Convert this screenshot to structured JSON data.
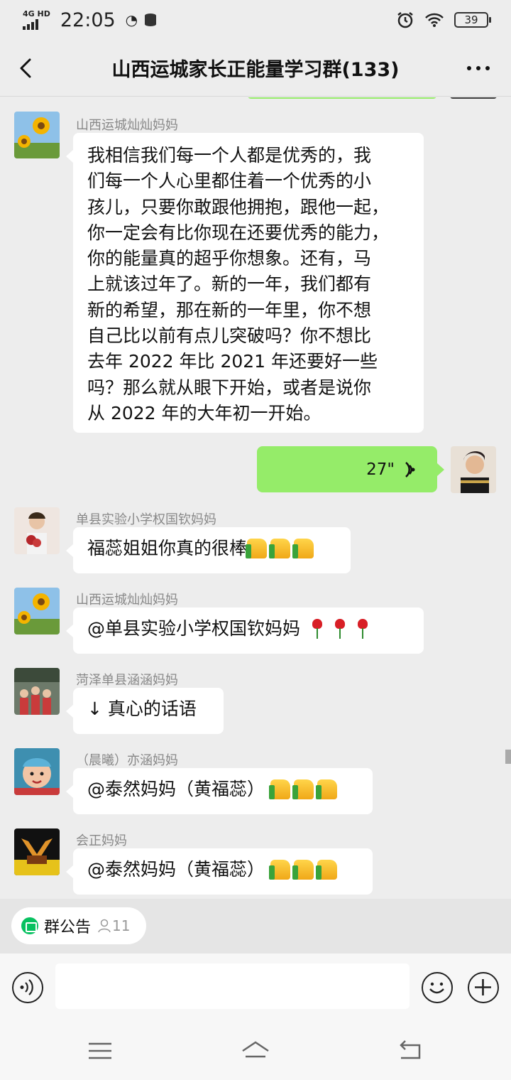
{
  "status_bar": {
    "network": "4G HD",
    "time": "22:05",
    "battery": "39"
  },
  "header": {
    "title": "山西运城家长正能量学习群(133)"
  },
  "messages": [
    {
      "sender": "山西运城灿灿妈妈",
      "text": "我相信我们每一个人都是优秀的，我\n们每一个人心里都住着一个优秀的小\n孩儿，只要你敢跟他拥抱，跟他一起，\n你一定会有比你现在还要优秀的能力，\n你的能量真的超乎你想象。还有，马\n上就该过年了。新的一年，我们都有\n新的希望，那在新的一年里，你不想\n自己比以前有点儿突破吗？你不想比\n去年 2022 年比 2021 年还要好一些\n吗？那么就从眼下开始，或者是说你\n从 2022 年的大年初一开始。"
    },
    {
      "voice_duration": "27\""
    },
    {
      "sender": "单县实验小学权国钦妈妈",
      "text": "福蕊姐姐你真的很棒"
    },
    {
      "sender": "山西运城灿灿妈妈",
      "text": "@单县实验小学权国钦妈妈"
    },
    {
      "sender": "菏泽单县涵涵妈妈",
      "text": "↓ 真心的话语"
    },
    {
      "sender": "（晨曦）亦涵妈妈",
      "text": "@泰然妈妈（黄福蕊）"
    },
    {
      "sender": "会正妈妈",
      "text": "@泰然妈妈（黄福蕊）"
    }
  ],
  "announcement": {
    "label": "群公告",
    "count": "11"
  },
  "colors": {
    "self_bubble": "#95ec69",
    "other_bubble": "#ffffff",
    "background": "#ededed",
    "accent_green": "#07c160"
  }
}
